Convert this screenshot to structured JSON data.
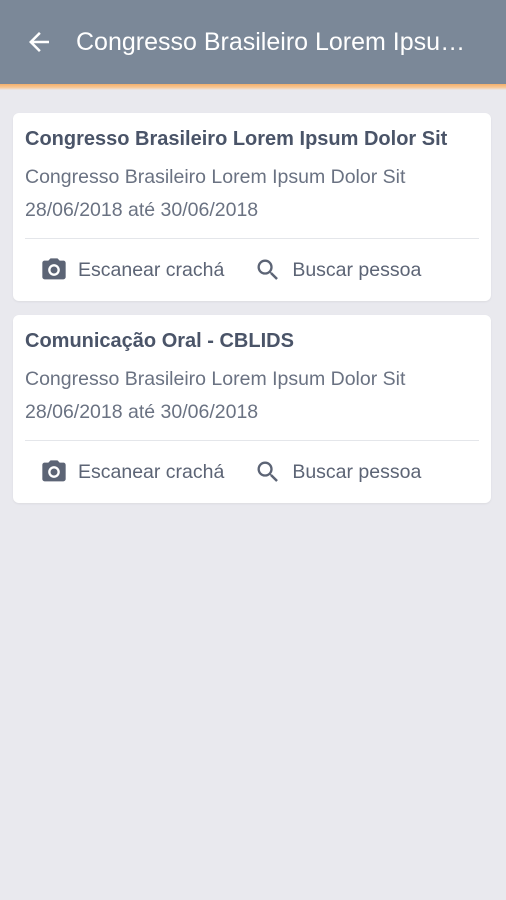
{
  "appbar": {
    "title": "Congresso Brasileiro Lorem Ipsum Dolor Sit",
    "back_icon": "arrow-left-icon",
    "background": "#7b8898",
    "accent": "#f4b06a"
  },
  "events": [
    {
      "title": "Congresso Brasileiro Lorem Ipsum Dolor Sit",
      "subtitle": "Congresso Brasileiro Lorem Ipsum Dolor Sit",
      "dates": "28/06/2018 até 30/06/2018",
      "scan_label": "Escanear crachá",
      "search_label": "Buscar pessoa"
    },
    {
      "title": "Comunicação Oral - CBLIDS",
      "subtitle": "Congresso Brasileiro Lorem Ipsum Dolor Sit",
      "dates": "28/06/2018 até 30/06/2018",
      "scan_label": "Escanear crachá",
      "search_label": "Buscar pessoa"
    }
  ],
  "icons": {
    "scan": "camera-icon",
    "search": "search-icon"
  }
}
